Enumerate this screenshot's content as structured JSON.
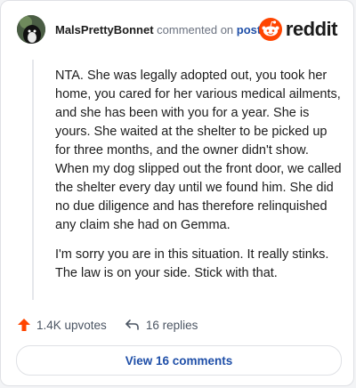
{
  "header": {
    "username": "MalsPrettyBonnet",
    "action_text": "commented on",
    "target_link": "post",
    "brand": "reddit",
    "avatar_icon": "dog-photo-avatar",
    "brand_icon": "reddit-snoo-icon"
  },
  "comment": {
    "paragraphs": [
      "NTA. She was legally adopted out, you took her home, you cared for her various medical ailments, and she has been with you for a year. She is yours. She waited at the shelter to be picked up for three months, and the owner didn't show. When my dog slipped out the front door, we called the shelter every day until we found him. She did no due diligence and has therefore relinquished any claim she had on Gemma.",
      "I'm sorry you are in this situation. It really stinks. The law is on your side. Stick with that."
    ]
  },
  "actions": {
    "upvotes": "1.4K upvotes",
    "replies": "16 replies",
    "upvote_icon": "upvote-arrow-icon",
    "reply_icon": "reply-arrow-icon"
  },
  "footer": {
    "view_button": "View 16 comments"
  },
  "colors": {
    "accent_orange": "#ff4500",
    "link_blue": "#1f4fa8",
    "text": "#1c1c1c",
    "muted": "#6b7280"
  }
}
